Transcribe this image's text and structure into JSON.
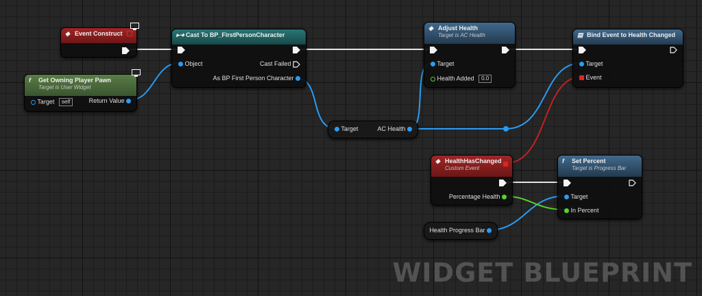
{
  "colors": {
    "event_header": "#8c1f1f",
    "function_header": "#4a6b3a",
    "cast_header": "#1f5c5c",
    "call_header": "#2b4f70",
    "object_pin": "#2a9cf4",
    "float_pin": "#56d32a",
    "delegate_pin": "#e02424",
    "exec_wire": "#e6e6e6"
  },
  "nodes": {
    "event_construct": {
      "title": "Event Construct"
    },
    "get_owning_player_pawn": {
      "title": "Get Owning Player Pawn",
      "subtitle": "Target is User Widget",
      "target_label": "Target",
      "target_value": "self",
      "return_label": "Return Value"
    },
    "cast_to": {
      "title": "Cast To BP_FirstPersonCharacter",
      "object_label": "Object",
      "cast_failed_label": "Cast Failed",
      "as_label": "As BP First Person Character"
    },
    "ac_health_getter": {
      "target_label": "Target",
      "output_label": "AC Health"
    },
    "adjust_health": {
      "title": "Adjust Health",
      "subtitle": "Target is AC Health",
      "target_label": "Target",
      "health_added_label": "Health Added",
      "health_added_value": "0.0"
    },
    "bind_event": {
      "title": "Bind Event to Health Changed",
      "target_label": "Target",
      "event_label": "Event"
    },
    "health_has_changed": {
      "title": "HealthHasChanged",
      "subtitle": "Custom Event",
      "output_label": "Percentage Health"
    },
    "set_percent": {
      "title": "Set Percent",
      "subtitle": "Target is Progress Bar",
      "target_label": "Target",
      "in_percent_label": "In Percent"
    },
    "health_progress_bar": {
      "label": "Health Progress Bar"
    }
  },
  "icons": {
    "event": "event-diamond-icon",
    "function": "function-f-icon",
    "cast": "cast-arrow-icon",
    "bind": "bind-event-icon",
    "monitor": "server-monitor-icon"
  },
  "watermark": "WIDGET BLUEPRINT"
}
